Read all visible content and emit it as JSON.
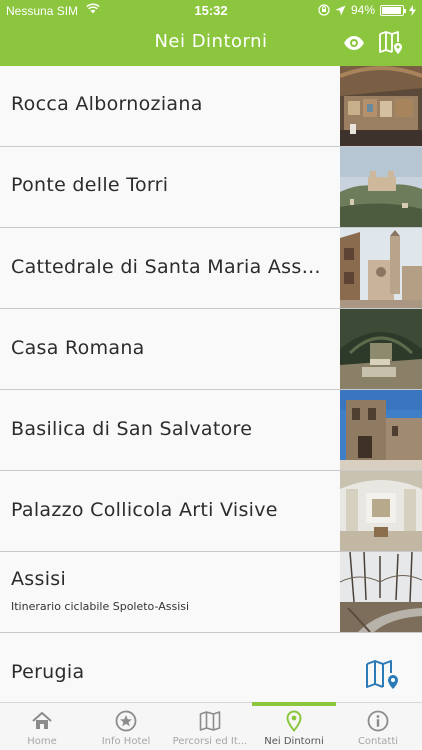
{
  "status_bar": {
    "carrier": "Nessuna SIM",
    "time": "15:32",
    "battery_percent": "94%",
    "battery_level": 0.94
  },
  "nav": {
    "title": "Nei Dintorni",
    "eye_icon": "eye-icon",
    "map_icon": "map-pin-icon"
  },
  "list": {
    "items": [
      {
        "title": "Rocca Albornoziana",
        "subtitle": "",
        "thumb": "fresco-hall"
      },
      {
        "title": "Ponte delle Torri",
        "subtitle": "",
        "thumb": "hill-fortress"
      },
      {
        "title": "Cattedrale di Santa Maria Assu...",
        "subtitle": "",
        "thumb": "cathedral-square"
      },
      {
        "title": "Casa Romana",
        "subtitle": "",
        "thumb": "roman-house"
      },
      {
        "title": "Basilica di San Salvatore",
        "subtitle": "",
        "thumb": "stone-basilica"
      },
      {
        "title": "Palazzo Collicola Arti Visive",
        "subtitle": "",
        "thumb": "palace-interior"
      },
      {
        "title": "Assisi",
        "subtitle": "Itinerario ciclabile Spoleto-Assisi",
        "thumb": "cycle-path"
      },
      {
        "title": "Perugia",
        "subtitle": "",
        "thumb": "map-icon"
      }
    ]
  },
  "tabbar": {
    "tabs": [
      {
        "label": "Home",
        "icon": "home-icon",
        "active": false
      },
      {
        "label": "Info Hotel",
        "icon": "star-badge-icon",
        "active": false
      },
      {
        "label": "Percorsi ed It...",
        "icon": "map-icon",
        "active": false
      },
      {
        "label": "Nei Dintorni",
        "icon": "map-pin-icon",
        "active": true
      },
      {
        "label": "Contatti",
        "icon": "info-icon",
        "active": false
      }
    ]
  },
  "colors": {
    "brand_green": "#8cc63f",
    "map_icon_blue": "#2a7ab8"
  }
}
